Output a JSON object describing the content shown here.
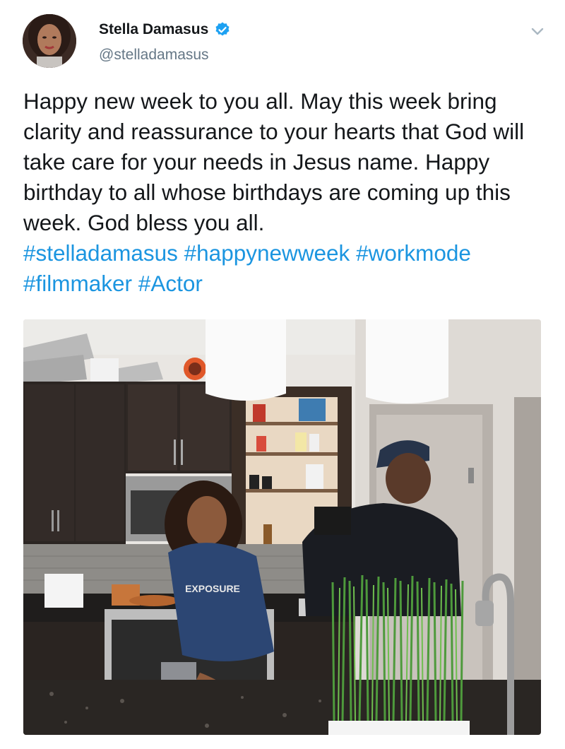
{
  "author": {
    "display_name": "Stella Damasus",
    "handle": "@stelladamasus",
    "verified": true,
    "avatar_icon": "profile-photo",
    "verified_icon": "verified-badge-icon",
    "verified_color": "#1da1f2"
  },
  "tweet": {
    "text": "Happy new week to you all. May this week bring clarity and reassurance to your hearts that God will take care for your needs in Jesus name. Happy birthday to all whose birthdays are coming up this week. God bless you all.",
    "hashtags": [
      "#stelladamasus",
      "#happynewweek",
      "#workmode",
      "#filmmaker",
      "#Actor"
    ],
    "hashtag_color": "#1b95e0"
  },
  "media": {
    "sweatshirt_text": "EXPOSURE",
    "icon": "photo-media"
  },
  "menu": {
    "icon": "chevron-down-icon",
    "icon_color": "#aab8c2"
  }
}
